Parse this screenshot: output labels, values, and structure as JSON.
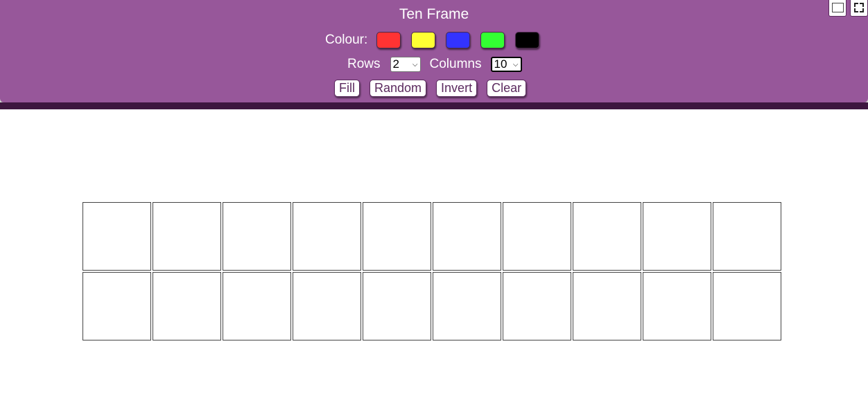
{
  "header": {
    "title": "Ten Frame",
    "colour_label": "Colour:",
    "colours": [
      {
        "name": "red",
        "hex": "#ff3333"
      },
      {
        "name": "yellow",
        "hex": "#ffff33"
      },
      {
        "name": "blue",
        "hex": "#3333ff"
      },
      {
        "name": "green",
        "hex": "#33ff33"
      },
      {
        "name": "black",
        "hex": "#000000"
      }
    ],
    "rows_label": "Rows",
    "rows_value": "2",
    "columns_label": "Columns",
    "columns_value": "10",
    "buttons": {
      "fill": "Fill",
      "random": "Random",
      "invert": "Invert",
      "clear": "Clear"
    }
  },
  "corner_controls": [
    "window-icon",
    "fullscreen-icon"
  ],
  "frame": {
    "rows": 2,
    "columns": 10
  },
  "theme": {
    "header_bg": "#97579a",
    "divider": "#3d163f",
    "button_text": "#5b2a5e"
  }
}
